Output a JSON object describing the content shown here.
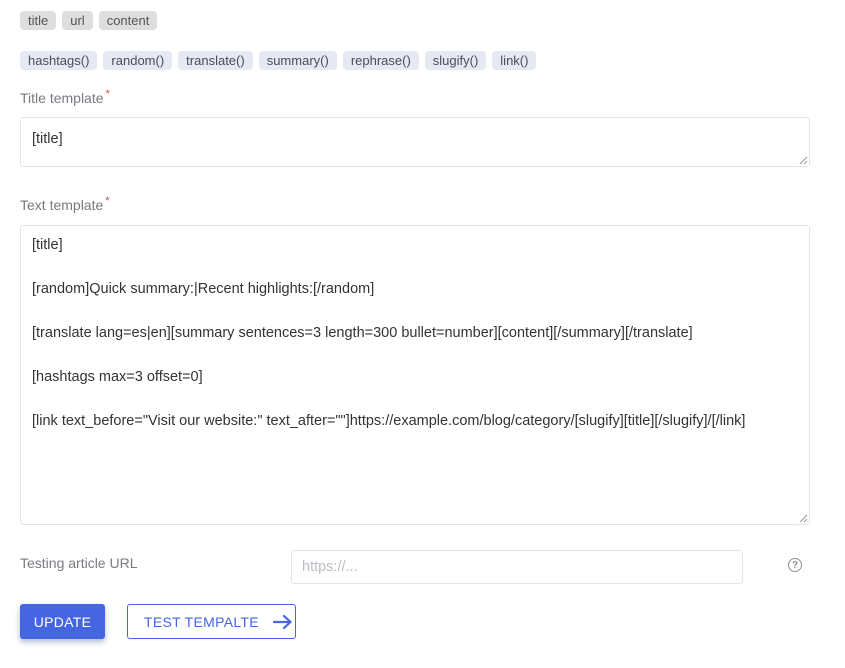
{
  "variables": [
    "title",
    "url",
    "content"
  ],
  "functions": [
    "hashtags()",
    "random()",
    "translate()",
    "summary()",
    "rephrase()",
    "slugify()",
    "link()"
  ],
  "title_template": {
    "label": "Title template",
    "required_mark": "*",
    "value": "[title]"
  },
  "text_template": {
    "label": "Text template",
    "required_mark": "*",
    "lines": [
      "[title]",
      "",
      "[random]Quick summary:|Recent highlights:[/random]",
      "",
      "[translate lang=es|en][summary sentences=3 length=300 bullet=number][content][/summary][/translate]",
      "",
      "[hashtags max=3 offset=0]",
      "",
      "[link text_before=\"Visit our website:\" text_after=\"\"]https://example.com/blog/category/[slugify][title][/slugify]/[/link]"
    ]
  },
  "testing_url": {
    "label": "Testing article URL",
    "placeholder": "https://...",
    "value": "",
    "help_icon": "question-circle-icon"
  },
  "buttons": {
    "update_label": "UPDATE",
    "test_label": "TEST TEMPALTE",
    "test_icon": "arrow-right-icon"
  },
  "colors": {
    "accent": "#4566e0",
    "required": "#e0485a",
    "var_chip_bg": "#dedede",
    "func_chip_bg": "#e6e9f2"
  }
}
